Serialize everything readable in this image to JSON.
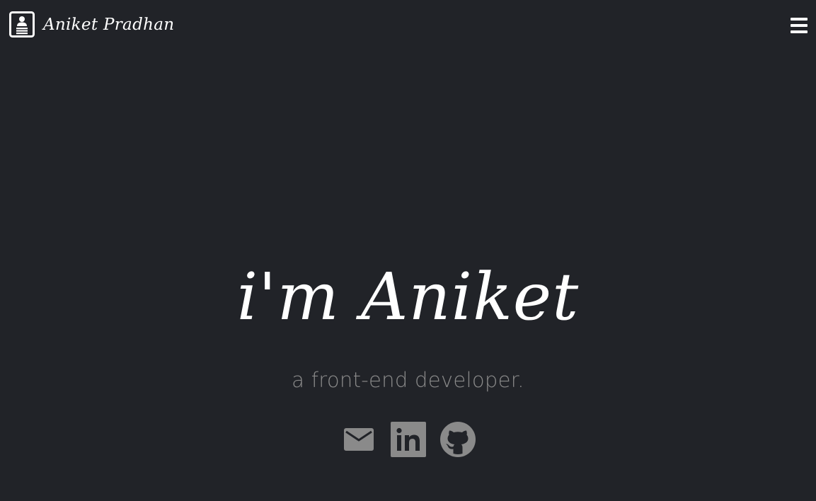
{
  "brand": {
    "name": "Aniket Pradhan",
    "icon": "contact-card-icon"
  },
  "navbar": {
    "menu_icon": "hamburger-menu-icon"
  },
  "hero": {
    "title": "i'm Aniket",
    "subtitle": "a front-end developer."
  },
  "socials": [
    {
      "icon": "email-icon"
    },
    {
      "icon": "linkedin-icon"
    },
    {
      "icon": "github-icon"
    }
  ],
  "colors": {
    "background": "#212328",
    "text": "#ffffff",
    "muted": "#8a8a8a"
  }
}
